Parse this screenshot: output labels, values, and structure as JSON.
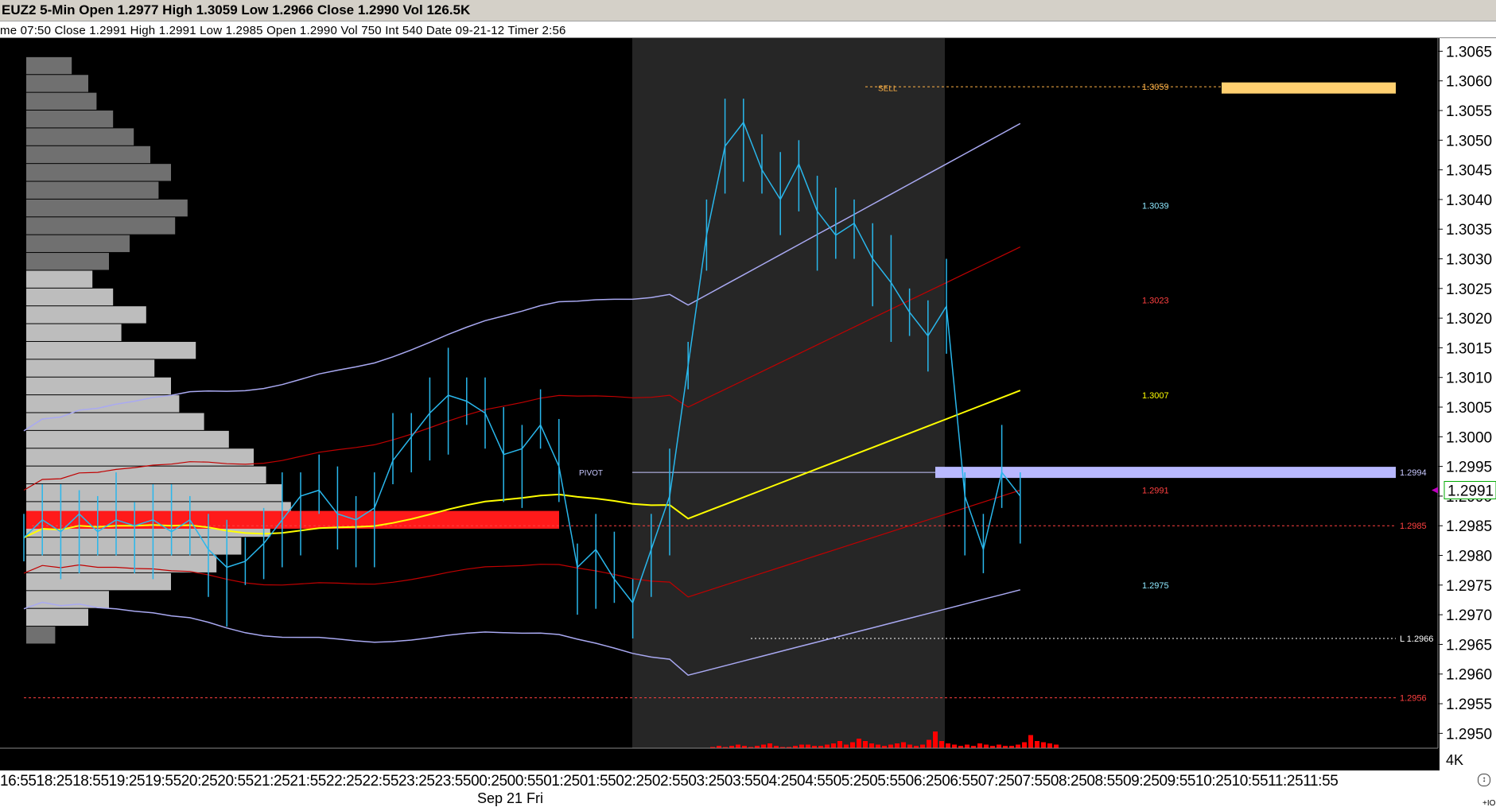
{
  "window": {
    "title": "EUZ2 5-Min Open 1.2977 High 1.3059 Low 1.2966 Close 1.2990 Vol 126.5K",
    "info": "me 07:50   Close 1.2991   High 1.2991   Low 1.2985   Open 1.2990   Vol 750   Int 540   Date 09-21-12   Timer 2:56"
  },
  "time_axis": {
    "labels": "16:5518:2518:5519:2519:5520:2520:5521:2521:5522:2522:5523:2523:5500:2500:5501:2501:5502:2502:5503:2503:5504:2504:5505:2505:5506:2506:5507:2507:5508:2508:5509:2509:5510:2510:5511:2511:55",
    "date": "Sep 21 Fri",
    "io": "+IO"
  },
  "price_axis": {
    "ticks": [
      "1.3065",
      "1.3060",
      "1.3055",
      "1.3050",
      "1.3045",
      "1.3040",
      "1.3035",
      "1.3030",
      "1.3025",
      "1.3020",
      "1.3015",
      "1.3010",
      "1.3005",
      "1.3000",
      "1.2995",
      "1.2990",
      "1.2985",
      "1.2980",
      "1.2975",
      "1.2970",
      "1.2965",
      "1.2960",
      "1.2955",
      "1.2950"
    ],
    "current_price": "1.2991",
    "volume_label": "4K"
  },
  "chart_data": {
    "type": "line",
    "symbol": "EUZ2",
    "interval": "5-Min",
    "ylim": [
      1.29475,
      1.30672
    ],
    "x_labels": [
      "16:55",
      "18:25",
      "18:55",
      "19:25",
      "19:55",
      "20:25",
      "20:55",
      "21:25",
      "21:55",
      "22:25",
      "22:55",
      "23:25",
      "23:55",
      "00:25",
      "00:55",
      "01:25",
      "01:55",
      "02:25",
      "02:55",
      "03:25",
      "03:55",
      "04:25",
      "04:55",
      "05:25",
      "05:55",
      "06:25",
      "06:55",
      "07:25",
      "07:55",
      "08:25",
      "08:55",
      "09:25",
      "09:55",
      "10:25",
      "10:55",
      "11:25",
      "11:55"
    ],
    "date": "Sep 21 Fri",
    "price_series": [
      {
        "t": 0,
        "v": 1.2983
      },
      {
        "t": 1,
        "v": 1.2986
      },
      {
        "t": 2,
        "v": 1.2984
      },
      {
        "t": 3,
        "v": 1.2987
      },
      {
        "t": 4,
        "v": 1.2984
      },
      {
        "t": 5,
        "v": 1.2986
      },
      {
        "t": 6,
        "v": 1.2985
      },
      {
        "t": 7,
        "v": 1.2986
      },
      {
        "t": 8,
        "v": 1.2984
      },
      {
        "t": 9,
        "v": 1.2986
      },
      {
        "t": 10,
        "v": 1.2981
      },
      {
        "t": 11,
        "v": 1.2978
      },
      {
        "t": 12,
        "v": 1.2979
      },
      {
        "t": 13,
        "v": 1.2982
      },
      {
        "t": 14,
        "v": 1.2986
      },
      {
        "t": 15,
        "v": 1.299
      },
      {
        "t": 16,
        "v": 1.2991
      },
      {
        "t": 17,
        "v": 1.2987
      },
      {
        "t": 18,
        "v": 1.2986
      },
      {
        "t": 19,
        "v": 1.2988
      },
      {
        "t": 20,
        "v": 1.2996
      },
      {
        "t": 21,
        "v": 1.3
      },
      {
        "t": 22,
        "v": 1.3004
      },
      {
        "t": 23,
        "v": 1.3007
      },
      {
        "t": 24,
        "v": 1.3006
      },
      {
        "t": 25,
        "v": 1.3004
      },
      {
        "t": 26,
        "v": 1.2997
      },
      {
        "t": 27,
        "v": 1.2998
      },
      {
        "t": 28,
        "v": 1.3002
      },
      {
        "t": 29,
        "v": 1.2995
      },
      {
        "t": 30,
        "v": 1.2978
      },
      {
        "t": 31,
        "v": 1.2981
      },
      {
        "t": 32,
        "v": 1.2976
      },
      {
        "t": 33,
        "v": 1.2972
      },
      {
        "t": 34,
        "v": 1.2981
      },
      {
        "t": 35,
        "v": 1.299
      },
      {
        "t": 36,
        "v": 1.3012
      },
      {
        "t": 37,
        "v": 1.3034
      },
      {
        "t": 38,
        "v": 1.3049
      },
      {
        "t": 39,
        "v": 1.3053
      },
      {
        "t": 40,
        "v": 1.3045
      },
      {
        "t": 41,
        "v": 1.304
      },
      {
        "t": 42,
        "v": 1.3046
      },
      {
        "t": 43,
        "v": 1.3038
      },
      {
        "t": 44,
        "v": 1.3034
      },
      {
        "t": 45,
        "v": 1.3036
      },
      {
        "t": 46,
        "v": 1.303
      },
      {
        "t": 47,
        "v": 1.3026
      },
      {
        "t": 48,
        "v": 1.3021
      },
      {
        "t": 49,
        "v": 1.3017
      },
      {
        "t": 50,
        "v": 1.3022
      },
      {
        "t": 51,
        "v": 1.299
      },
      {
        "t": 52,
        "v": 1.2981
      },
      {
        "t": 53,
        "v": 1.2994
      },
      {
        "t": 54,
        "v": 1.299
      }
    ],
    "reference_lines": [
      {
        "name": "SELL",
        "value": 1.3059,
        "label": "1.3059",
        "label2": "1.3058"
      },
      {
        "name": "upper-band-2",
        "value": 1.3039,
        "label": "1.3039"
      },
      {
        "name": "upper-band-1",
        "value": 1.3023,
        "label": "1.3023"
      },
      {
        "name": "VWAP",
        "value": 1.3007,
        "label": "1.3007"
      },
      {
        "name": "PIVOT",
        "value": 1.2994,
        "label": "1.2994"
      },
      {
        "name": "lower-band-1",
        "value": 1.2991,
        "label": "1.2991"
      },
      {
        "name": "prior",
        "value": 1.2985,
        "label": "1.2985"
      },
      {
        "name": "lower-band-2",
        "value": 1.2975,
        "label": "1.2975"
      },
      {
        "name": "LOW",
        "value": 1.2966,
        "label": "L 1.2966"
      },
      {
        "name": "prior-low",
        "value": 1.2956,
        "label": "1.2956"
      }
    ],
    "volume_max_label": "4K"
  },
  "labels": {
    "sell": "SELL",
    "pivot": "PIVOT"
  },
  "colors": {
    "background": "#000000",
    "price": "#29b7ec",
    "band_outer": "#a9a9f2",
    "band_inner": "#c00000",
    "vwap": "#ffff00",
    "pivot_band": "#b8b8ff",
    "sell_band": "#ffd070",
    "profile_dark": "#707070",
    "profile_light": "#bdbdbd",
    "session": "#262626",
    "volume": "#ff0000"
  }
}
